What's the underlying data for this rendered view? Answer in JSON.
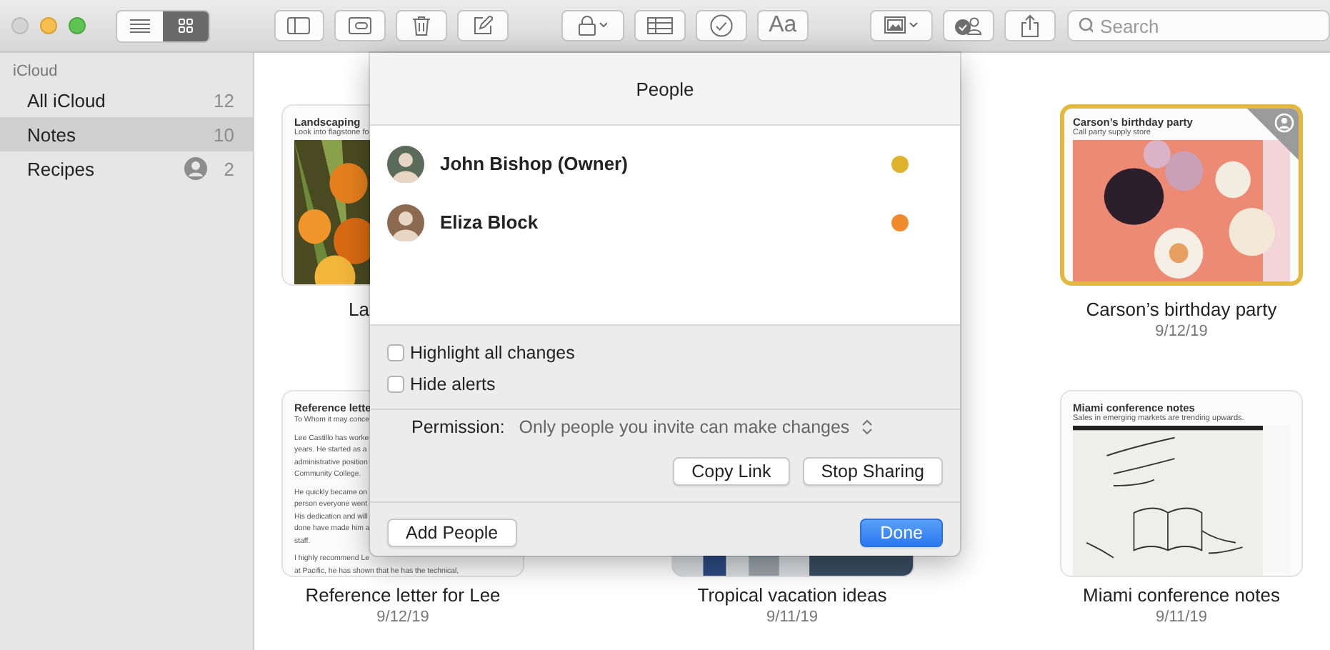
{
  "toolbar": {
    "view_modes": [
      {
        "kind": "list",
        "selected": false
      },
      {
        "kind": "grid",
        "selected": true
      }
    ],
    "format_button": "Aa",
    "search": {
      "placeholder": "Search"
    }
  },
  "sidebar": {
    "section": "iCloud",
    "items": [
      {
        "label": "All iCloud",
        "count": "12",
        "selected": false,
        "shared": false
      },
      {
        "label": "Notes",
        "count": "10",
        "selected": true,
        "shared": false
      },
      {
        "label": "Recipes",
        "count": "2",
        "selected": false,
        "shared": true
      }
    ]
  },
  "notes": [
    [
      {
        "title": "Landscaping",
        "subtitle": "Look into flagstone fo",
        "kind": "picture",
        "caption": "La",
        "clipped": true,
        "selected": false,
        "shared": false
      },
      {
        "title": "Carson’s birthday party",
        "subtitle": "Call party supply store",
        "kind": "picture",
        "caption": "Carson’s birthday party",
        "date": "9/12/19",
        "clipped": false,
        "selected": true,
        "shared": true
      }
    ],
    [
      {
        "title": "Reference lette",
        "body": [
          "To Whom it may conce",
          "Lee Castillo has worke",
          "years. He started as a",
          "administrative position",
          "Community College.",
          "He quickly became on",
          "person everyone went",
          "His dedication and will",
          "done have made him a",
          "staff.",
          "I highly recommend Le",
          "at Pacific, he has shown that he has the technical,"
        ],
        "caption": "Reference letter for Lee",
        "date": "9/12/19",
        "clipped": false,
        "selected": false,
        "shared": false
      },
      {
        "kind": "picture",
        "caption": "Tropical vacation ideas",
        "date": "9/11/19",
        "clipped": false,
        "selected": false,
        "shared": false
      },
      {
        "title": "Miami conference notes",
        "subtitle": "Sales in emerging markets are trending upwards.",
        "kind": "picture",
        "caption": "Miami conference notes",
        "date": "9/11/19",
        "clipped": false,
        "selected": false,
        "shared": false
      }
    ]
  ],
  "people_popover": {
    "title": "People",
    "participants": [
      {
        "name": "John Bishop (Owner)",
        "color": "#dfb22c"
      },
      {
        "name": "Eliza Block",
        "color": "#ef8b2c"
      }
    ],
    "options": [
      {
        "label": "Highlight all changes",
        "checked": false
      },
      {
        "label": "Hide alerts",
        "checked": false
      }
    ],
    "permission_label": "Permission:",
    "permission_value": "Only people you invite can make changes",
    "copy_link_button": "Copy Link",
    "stop_sharing_button": "Stop Sharing",
    "add_people_button": "Add People",
    "done_button": "Done"
  }
}
